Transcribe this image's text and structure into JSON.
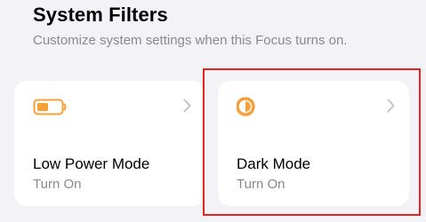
{
  "section": {
    "title": "System Filters",
    "subtitle": "Customize system settings when this Focus turns on."
  },
  "filters": [
    {
      "label": "Low Power Mode",
      "status": "Turn On",
      "icon": "battery-icon",
      "icon_color": "#f7a03a"
    },
    {
      "label": "Dark Mode",
      "status": "Turn On",
      "icon": "dark-mode-icon",
      "icon_color": "#f7a03a",
      "highlighted": true
    }
  ],
  "colors": {
    "background": "#f2f2f7",
    "card": "#ffffff",
    "secondary_text": "#8a8a8e",
    "chevron": "#c4c4c7",
    "highlight": "#e5241f"
  }
}
